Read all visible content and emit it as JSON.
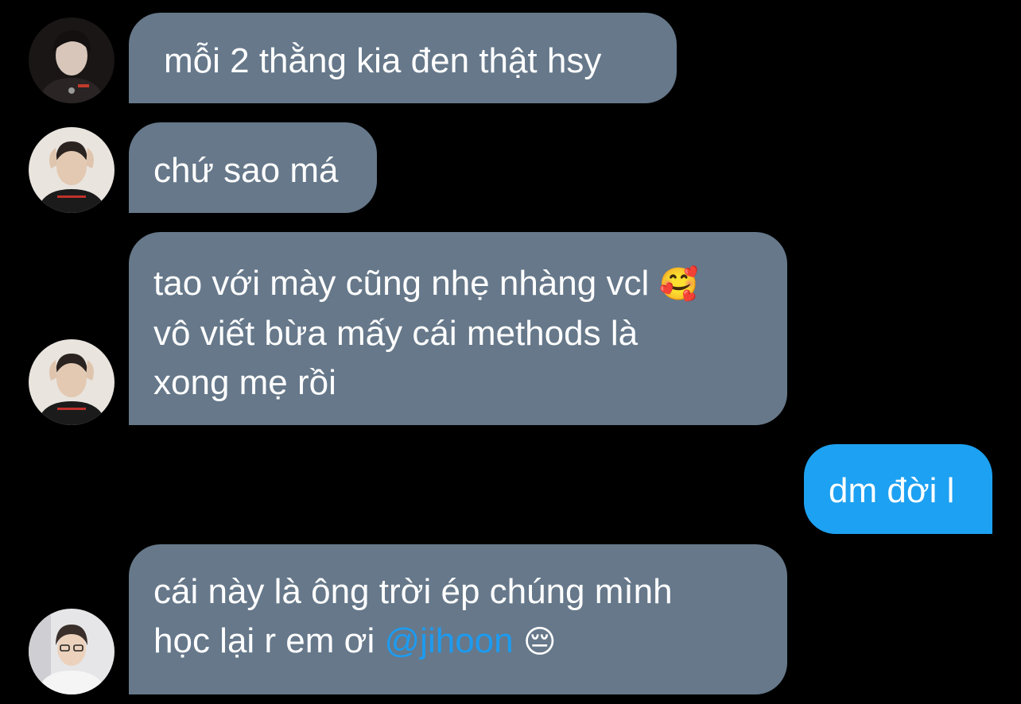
{
  "colors": {
    "background": "#000000",
    "incoming_bubble": "#66788a",
    "outgoing_bubble": "#1da1f2",
    "mention": "#1d9bf0",
    "text": "#ffffff"
  },
  "messages": [
    {
      "direction": "incoming",
      "avatar": "avatar-photo-1",
      "text": "mỗi 2 thằng kia đen thật hsy"
    },
    {
      "direction": "incoming",
      "avatar": "avatar-photo-2",
      "text": "chứ sao má"
    },
    {
      "direction": "incoming",
      "avatar": "avatar-photo-2",
      "line1": "tao với mày cũng nhẹ nhàng vcl",
      "line1_emoji": "🥰",
      "line1_emoji_name": "smiling-face-with-hearts-emoji",
      "line2": "vô viết bừa mấy cái methods là",
      "line3": "xong mẹ rồi"
    },
    {
      "direction": "outgoing",
      "text": "dm đời l"
    },
    {
      "direction": "incoming",
      "avatar": "avatar-photo-3",
      "line1": "cái này là ông trời ép chúng mình",
      "line2_prefix": "học lại r em ơi",
      "mention": "@jihoon",
      "emoji": "😔",
      "emoji_name": "pensive-face-emoji"
    }
  ]
}
